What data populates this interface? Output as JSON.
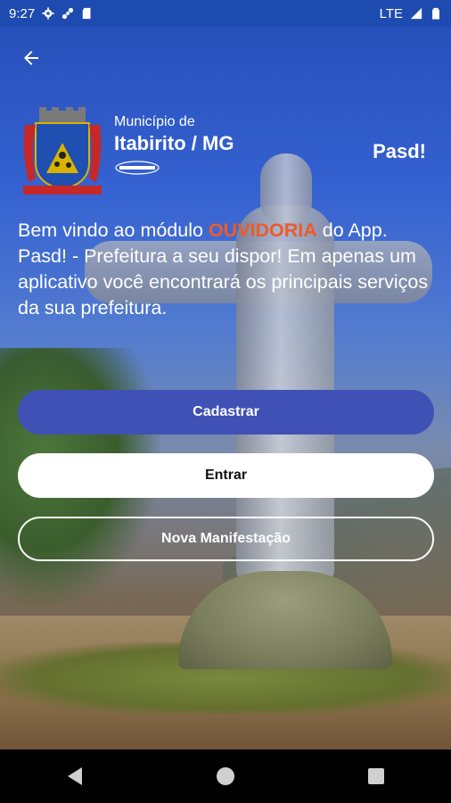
{
  "status_bar": {
    "time": "9:27",
    "network": "LTE",
    "left_icons": [
      "settings-icon",
      "link-icon",
      "sd-card-icon"
    ],
    "right_icons": [
      "signal-icon",
      "battery-icon"
    ]
  },
  "header": {
    "back_icon": "back-arrow-icon",
    "municipality_label": "Município de",
    "city": "Itabirito / MG",
    "app_name": "Pasd!"
  },
  "welcome": {
    "prefix": "Bem vindo ao módulo ",
    "highlight": "OUVIDORIA",
    "suffix": " do App. Pasd! - Prefeitura a seu dispor! Em apenas um aplicativo você encontrará os principais serviços da sua prefeitura.",
    "highlight_color": "#f15a24"
  },
  "buttons": {
    "register": "Cadastrar",
    "login": "Entrar",
    "new_manifestation": "Nova Manifestação"
  },
  "colors": {
    "primary": "#3f51b5",
    "statusbar": "#1e4bb0"
  }
}
